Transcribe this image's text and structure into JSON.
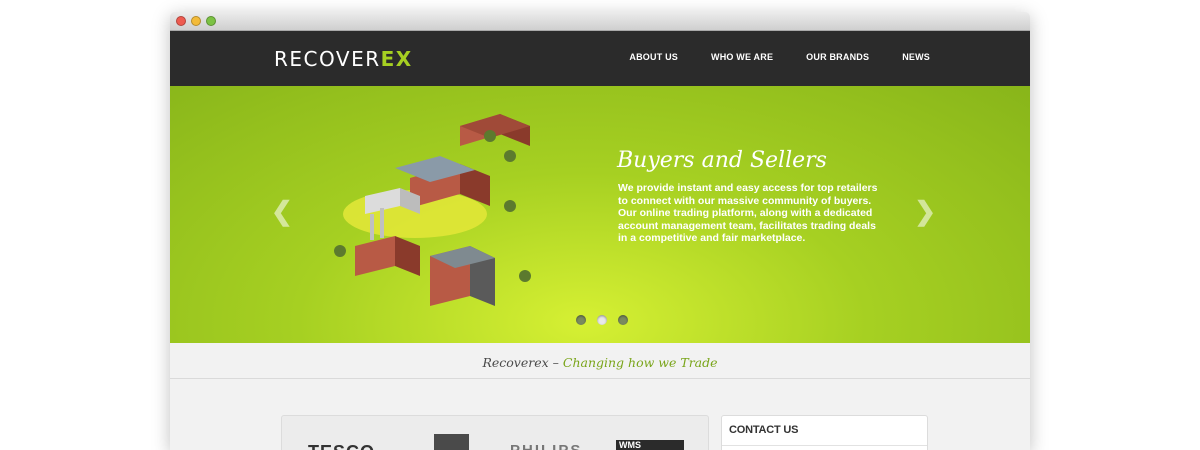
{
  "header": {
    "logo_main": "RECOVER",
    "logo_accent": "EX",
    "nav": [
      "ABOUT US",
      "WHO WE ARE",
      "OUR BRANDS",
      "NEWS"
    ]
  },
  "hero": {
    "title": "Buyers and Sellers",
    "text": "We provide instant and easy access for top retailers to connect with our massive community of buyers. Our online trading platform, along with a dedicated account management team, facilitates trading deals in a competitive and fair marketplace.",
    "prev_icon": "chevron-left-icon",
    "next_icon": "chevron-right-icon",
    "slide_count": 3,
    "active_slide": 2
  },
  "tagline": {
    "brand": "Recoverex – ",
    "slogan": "Changing how we Trade"
  },
  "brands": [
    "TESCO",
    "PHILIPS",
    "WMS"
  ],
  "contact": {
    "title": "CONTACT US"
  },
  "colors": {
    "accent": "#a6d022",
    "header_bg": "#2b2b2b",
    "slogan": "#7aa51a"
  }
}
